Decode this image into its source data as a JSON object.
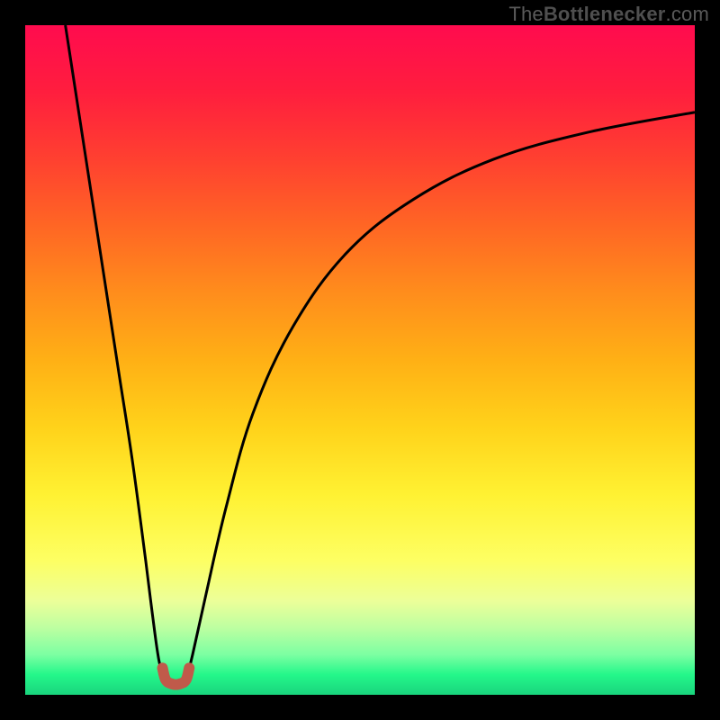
{
  "watermark": {
    "prefix": "The",
    "bold": "Bottlenecker",
    "suffix": ".com"
  },
  "chart_data": {
    "type": "line",
    "title": "",
    "xlabel": "",
    "ylabel": "",
    "xlim": [
      0,
      100
    ],
    "ylim": [
      0,
      100
    ],
    "legend": false,
    "grid": false,
    "background_gradient": {
      "orientation": "vertical",
      "stops": [
        {
          "pos": 0.0,
          "color": "#ff0b4e"
        },
        {
          "pos": 0.5,
          "color": "#ffb015"
        },
        {
          "pos": 0.8,
          "color": "#fdff63"
        },
        {
          "pos": 1.0,
          "color": "#19d47d"
        }
      ]
    },
    "series": [
      {
        "name": "left-branch",
        "stroke": "#000000",
        "stroke_width": 3,
        "x": [
          6,
          8,
          10,
          12,
          14,
          16,
          18,
          19,
          20,
          21
        ],
        "y": [
          100,
          87,
          74,
          61,
          48,
          35,
          20,
          12,
          5,
          2
        ]
      },
      {
        "name": "right-branch",
        "stroke": "#000000",
        "stroke_width": 3,
        "x": [
          24,
          25,
          27,
          30,
          34,
          40,
          48,
          58,
          70,
          84,
          100
        ],
        "y": [
          2,
          6,
          15,
          28,
          42,
          55,
          66,
          74,
          80,
          84,
          87
        ]
      },
      {
        "name": "trough-highlight",
        "stroke": "#c05a4a",
        "stroke_width": 12,
        "linecap": "round",
        "x": [
          20.5,
          21.0,
          22.0,
          23.0,
          24.0,
          24.5
        ],
        "y": [
          4.0,
          2.2,
          1.6,
          1.6,
          2.2,
          4.0
        ]
      }
    ]
  }
}
